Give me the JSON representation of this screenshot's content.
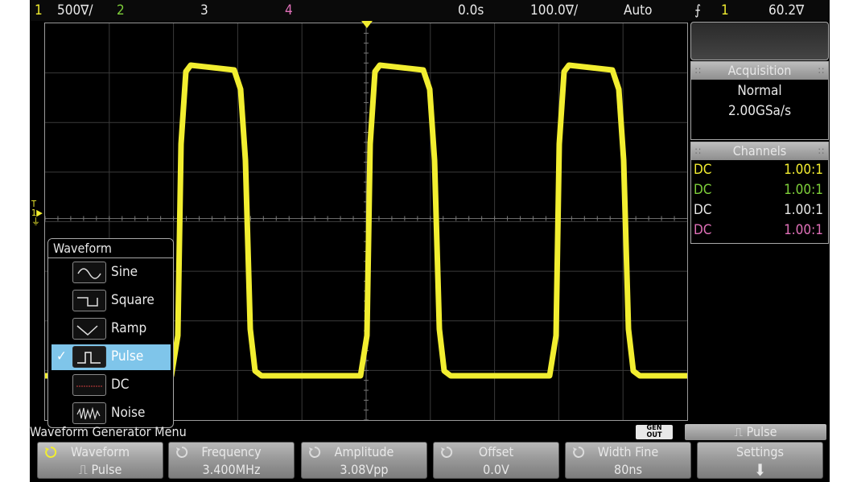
{
  "status_bar": {
    "ch1_num": "1",
    "ch1_scale": "500∇/",
    "ch2_num": "2",
    "ch3_num": "3",
    "ch4_num": "4",
    "time_delay": "0.0s",
    "time_scale": "100.0∇/",
    "trigger_mode": "Auto",
    "trigger_source": "1",
    "trigger_level": "60.2∇"
  },
  "acquisition": {
    "title": "Acquisition",
    "mode": "Normal",
    "rate": "2.00GSa/s"
  },
  "channels": {
    "title": "Channels",
    "rows": [
      {
        "coupling": "DC",
        "probe": "1.00:1",
        "color": "#f2ee30"
      },
      {
        "coupling": "DC",
        "probe": "1.00:1",
        "color": "#7fcf3a"
      },
      {
        "coupling": "DC",
        "probe": "1.00:1",
        "color": "#e8e8e8"
      },
      {
        "coupling": "DC",
        "probe": "1.00:1",
        "color": "#e070b8"
      }
    ]
  },
  "waveform_menu": {
    "title": "Waveform",
    "items": [
      {
        "label": "Sine",
        "icon": "sine-icon",
        "selected": false
      },
      {
        "label": "Square",
        "icon": "square-wave-icon",
        "selected": false
      },
      {
        "label": "Ramp",
        "icon": "ramp-icon",
        "selected": false
      },
      {
        "label": "Pulse",
        "icon": "pulse-icon",
        "selected": true,
        "check": "✓"
      },
      {
        "label": "DC",
        "icon": "dc-icon",
        "selected": false
      },
      {
        "label": "Noise",
        "icon": "noise-icon",
        "selected": false
      }
    ]
  },
  "menu_title": "Waveform Generator Menu",
  "gen_out": {
    "line1": "GEN",
    "line2": "OUT"
  },
  "pulse_badge": "Pulse",
  "softkeys": [
    {
      "label": "Waveform",
      "value": "Pulse"
    },
    {
      "label": "Frequency",
      "value": "3.400MHz"
    },
    {
      "label": "Amplitude",
      "value": "3.08Vpp"
    },
    {
      "label": "Offset",
      "value": "0.0V"
    },
    {
      "label": "Width Fine",
      "value": "80ns"
    },
    {
      "label": "Settings",
      "value": ""
    }
  ],
  "colors": {
    "ch1": "#f2ee30",
    "ch2": "#7fcf3a",
    "ch3": "#e8e8e8",
    "ch4": "#e070b8",
    "trace": "#f2ee30"
  }
}
